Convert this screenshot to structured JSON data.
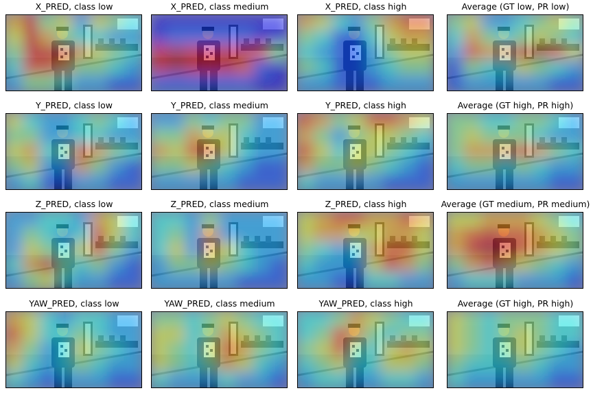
{
  "panels": [
    {
      "title": "X_PRED, class low",
      "heat": [
        [
          0.7,
          0.9,
          0.5,
          0.6,
          0.3,
          0.6,
          0.5,
          0.4
        ],
        [
          0.6,
          0.9,
          0.7,
          0.5,
          0.4,
          0.4,
          0.3,
          0.3
        ],
        [
          0.5,
          0.9,
          0.9,
          0.9,
          0.7,
          0.6,
          0.5,
          0.4
        ],
        [
          0.4,
          0.8,
          0.8,
          0.7,
          0.5,
          0.5,
          0.4,
          0.3
        ],
        [
          0.3,
          0.5,
          0.5,
          0.4,
          0.3,
          0.3,
          0.2,
          0.2
        ]
      ]
    },
    {
      "title": "X_PRED, class medium",
      "heat": [
        [
          0.1,
          0.1,
          0.1,
          0.1,
          0.1,
          0.1,
          0.1,
          0.1
        ],
        [
          0.1,
          0.2,
          0.2,
          0.2,
          0.2,
          0.2,
          0.1,
          0.1
        ],
        [
          0.9,
          0.95,
          0.9,
          0.9,
          0.9,
          0.9,
          0.8,
          0.5
        ],
        [
          0.9,
          0.95,
          0.9,
          0.85,
          0.9,
          0.8,
          0.2,
          0.1
        ],
        [
          0.2,
          0.2,
          0.2,
          0.2,
          0.2,
          0.2,
          0.1,
          0.1
        ]
      ]
    },
    {
      "title": "X_PRED, class high",
      "heat": [
        [
          0.7,
          0.6,
          0.4,
          0.3,
          0.5,
          0.7,
          0.8,
          0.8
        ],
        [
          0.5,
          0.4,
          0.2,
          0.2,
          0.4,
          0.6,
          0.7,
          0.7
        ],
        [
          0.4,
          0.3,
          0.2,
          0.2,
          0.3,
          0.5,
          0.6,
          0.6
        ],
        [
          0.5,
          0.4,
          0.2,
          0.2,
          0.3,
          0.4,
          0.5,
          0.5
        ],
        [
          0.3,
          0.3,
          0.2,
          0.2,
          0.2,
          0.3,
          0.3,
          0.3
        ]
      ]
    },
    {
      "title": "Average (GT low, PR low)",
      "heat": [
        [
          0.5,
          0.6,
          0.3,
          0.3,
          0.4,
          0.5,
          0.6,
          0.5
        ],
        [
          0.4,
          0.7,
          0.5,
          0.4,
          0.5,
          0.6,
          0.5,
          0.4
        ],
        [
          0.3,
          0.8,
          0.7,
          0.7,
          0.9,
          0.95,
          0.8,
          0.6
        ],
        [
          0.2,
          0.5,
          0.4,
          0.4,
          0.6,
          0.5,
          0.4,
          0.3
        ],
        [
          0.2,
          0.3,
          0.3,
          0.3,
          0.3,
          0.3,
          0.2,
          0.2
        ]
      ]
    },
    {
      "title": "Y_PRED, class low",
      "heat": [
        [
          0.6,
          0.4,
          0.3,
          0.3,
          0.4,
          0.5,
          0.4,
          0.3
        ],
        [
          0.5,
          0.5,
          0.3,
          0.3,
          0.4,
          0.4,
          0.3,
          0.3
        ],
        [
          0.6,
          0.7,
          0.4,
          0.5,
          0.8,
          0.7,
          0.5,
          0.4
        ],
        [
          0.5,
          0.6,
          0.3,
          0.3,
          0.7,
          0.5,
          0.3,
          0.2
        ],
        [
          0.3,
          0.4,
          0.2,
          0.2,
          0.3,
          0.3,
          0.2,
          0.2
        ]
      ]
    },
    {
      "title": "Y_PRED, class medium",
      "heat": [
        [
          0.3,
          0.3,
          0.5,
          0.4,
          0.5,
          0.5,
          0.3,
          0.3
        ],
        [
          0.5,
          0.5,
          0.7,
          0.6,
          0.6,
          0.4,
          0.3,
          0.3
        ],
        [
          0.7,
          0.6,
          0.8,
          0.8,
          0.6,
          0.4,
          0.3,
          0.3
        ],
        [
          0.5,
          0.5,
          0.6,
          0.5,
          0.4,
          0.3,
          0.2,
          0.2
        ],
        [
          0.3,
          0.3,
          0.3,
          0.3,
          0.3,
          0.2,
          0.2,
          0.2
        ]
      ]
    },
    {
      "title": "Y_PRED, class high",
      "heat": [
        [
          0.8,
          0.7,
          0.5,
          0.6,
          0.8,
          0.8,
          0.7,
          0.6
        ],
        [
          0.7,
          0.5,
          0.3,
          0.5,
          0.6,
          0.6,
          0.5,
          0.4
        ],
        [
          0.8,
          0.6,
          0.4,
          0.6,
          0.6,
          0.5,
          0.4,
          0.3
        ],
        [
          0.7,
          0.5,
          0.5,
          0.6,
          0.5,
          0.4,
          0.3,
          0.2
        ],
        [
          0.4,
          0.3,
          0.3,
          0.3,
          0.3,
          0.2,
          0.2,
          0.2
        ]
      ]
    },
    {
      "title": "Average (GT high, PR high)",
      "heat": [
        [
          0.5,
          0.5,
          0.4,
          0.4,
          0.5,
          0.5,
          0.4,
          0.3
        ],
        [
          0.5,
          0.6,
          0.5,
          0.5,
          0.5,
          0.4,
          0.3,
          0.3
        ],
        [
          0.5,
          0.7,
          0.7,
          0.7,
          0.8,
          0.7,
          0.5,
          0.4
        ],
        [
          0.4,
          0.5,
          0.5,
          0.4,
          0.5,
          0.4,
          0.3,
          0.3
        ],
        [
          0.3,
          0.3,
          0.3,
          0.3,
          0.3,
          0.3,
          0.2,
          0.2
        ]
      ]
    },
    {
      "title": "Z_PRED, class low",
      "heat": [
        [
          0.3,
          0.3,
          0.4,
          0.4,
          0.3,
          0.7,
          0.6,
          0.4
        ],
        [
          0.3,
          0.5,
          0.4,
          0.3,
          0.4,
          0.8,
          0.6,
          0.4
        ],
        [
          0.3,
          0.6,
          0.5,
          0.4,
          0.6,
          0.8,
          0.5,
          0.3
        ],
        [
          0.4,
          0.7,
          0.9,
          0.5,
          0.4,
          0.5,
          0.3,
          0.2
        ],
        [
          0.3,
          0.5,
          0.6,
          0.4,
          0.3,
          0.3,
          0.2,
          0.2
        ]
      ]
    },
    {
      "title": "Z_PRED, class medium",
      "heat": [
        [
          0.4,
          0.4,
          0.3,
          0.5,
          0.3,
          0.3,
          0.3,
          0.3
        ],
        [
          0.4,
          0.5,
          0.3,
          0.7,
          0.3,
          0.3,
          0.3,
          0.3
        ],
        [
          0.4,
          0.6,
          0.3,
          0.7,
          0.6,
          0.4,
          0.3,
          0.3
        ],
        [
          0.3,
          0.5,
          0.5,
          0.6,
          0.5,
          0.4,
          0.3,
          0.2
        ],
        [
          0.3,
          0.3,
          0.3,
          0.3,
          0.3,
          0.2,
          0.2,
          0.2
        ]
      ]
    },
    {
      "title": "Z_PRED, class high",
      "heat": [
        [
          0.6,
          0.7,
          0.8,
          0.8,
          0.7,
          0.7,
          0.8,
          0.7
        ],
        [
          0.6,
          0.7,
          0.7,
          0.6,
          0.6,
          0.7,
          0.7,
          0.6
        ],
        [
          0.5,
          0.4,
          0.3,
          0.4,
          0.7,
          0.8,
          0.8,
          0.6
        ],
        [
          0.4,
          0.3,
          0.3,
          0.3,
          0.6,
          0.8,
          0.7,
          0.5
        ],
        [
          0.3,
          0.3,
          0.2,
          0.2,
          0.4,
          0.4,
          0.3,
          0.3
        ]
      ]
    },
    {
      "title": "Average (GT medium, PR medium)",
      "heat": [
        [
          0.6,
          0.6,
          0.7,
          0.7,
          0.7,
          0.6,
          0.5,
          0.4
        ],
        [
          0.7,
          0.8,
          0.9,
          0.8,
          0.8,
          0.7,
          0.6,
          0.5
        ],
        [
          0.7,
          0.9,
          0.95,
          0.9,
          0.8,
          0.7,
          0.6,
          0.5
        ],
        [
          0.5,
          0.7,
          0.8,
          0.7,
          0.6,
          0.5,
          0.4,
          0.3
        ],
        [
          0.3,
          0.4,
          0.4,
          0.4,
          0.3,
          0.3,
          0.3,
          0.2
        ]
      ]
    },
    {
      "title": "YAW_PRED, class low",
      "heat": [
        [
          0.7,
          0.6,
          0.4,
          0.3,
          0.4,
          0.4,
          0.3,
          0.3
        ],
        [
          0.8,
          0.6,
          0.4,
          0.4,
          0.5,
          0.4,
          0.3,
          0.3
        ],
        [
          0.7,
          0.5,
          0.3,
          0.4,
          0.6,
          0.5,
          0.4,
          0.3
        ],
        [
          0.6,
          0.4,
          0.3,
          0.4,
          0.5,
          0.4,
          0.3,
          0.3
        ],
        [
          0.4,
          0.3,
          0.2,
          0.3,
          0.3,
          0.3,
          0.2,
          0.2
        ]
      ]
    },
    {
      "title": "YAW_PRED, class medium",
      "heat": [
        [
          0.5,
          0.5,
          0.4,
          0.5,
          0.6,
          0.5,
          0.4,
          0.4
        ],
        [
          0.6,
          0.6,
          0.4,
          0.5,
          0.7,
          0.6,
          0.5,
          0.4
        ],
        [
          0.6,
          0.5,
          0.4,
          0.6,
          0.8,
          0.7,
          0.5,
          0.4
        ],
        [
          0.6,
          0.5,
          0.4,
          0.5,
          0.7,
          0.6,
          0.4,
          0.3
        ],
        [
          0.4,
          0.3,
          0.3,
          0.3,
          0.4,
          0.3,
          0.3,
          0.2
        ]
      ]
    },
    {
      "title": "YAW_PRED, class high",
      "heat": [
        [
          0.4,
          0.4,
          0.5,
          0.7,
          0.6,
          0.5,
          0.4,
          0.4
        ],
        [
          0.4,
          0.5,
          0.8,
          0.7,
          0.5,
          0.4,
          0.5,
          0.5
        ],
        [
          0.5,
          0.6,
          0.8,
          0.5,
          0.4,
          0.6,
          0.7,
          0.6
        ],
        [
          0.4,
          0.5,
          0.6,
          0.4,
          0.4,
          0.6,
          0.6,
          0.5
        ],
        [
          0.3,
          0.4,
          0.4,
          0.3,
          0.3,
          0.4,
          0.4,
          0.3
        ]
      ]
    },
    {
      "title": "Average (GT high, PR high)",
      "heat": [
        [
          0.6,
          0.5,
          0.4,
          0.5,
          0.5,
          0.5,
          0.4,
          0.4
        ],
        [
          0.6,
          0.5,
          0.4,
          0.5,
          0.6,
          0.5,
          0.4,
          0.4
        ],
        [
          0.6,
          0.5,
          0.4,
          0.5,
          0.6,
          0.5,
          0.4,
          0.3
        ],
        [
          0.5,
          0.4,
          0.4,
          0.4,
          0.5,
          0.4,
          0.3,
          0.3
        ],
        [
          0.4,
          0.3,
          0.3,
          0.3,
          0.3,
          0.3,
          0.2,
          0.2
        ]
      ]
    }
  ]
}
